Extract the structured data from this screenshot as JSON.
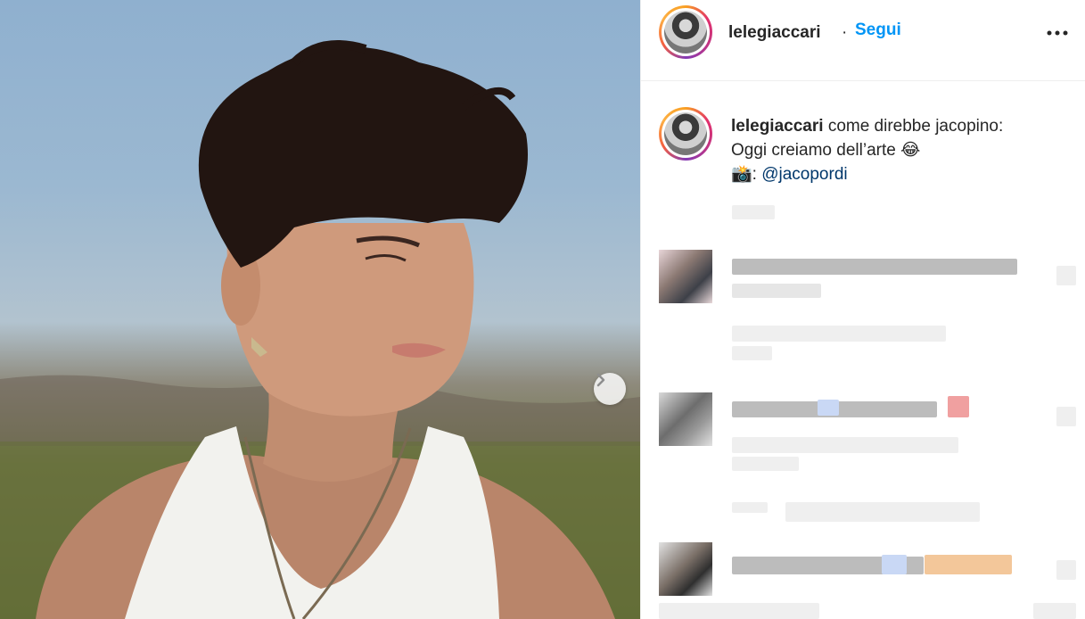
{
  "post": {
    "username": "lelegiaccari",
    "separator": "·",
    "follow_label": "Segui",
    "more_icon": "more-options-icon",
    "next_icon": "chevron-right-icon"
  },
  "caption": {
    "username": "lelegiaccari",
    "line1": "come direbbe jacopino:",
    "line2": "Oggi creiamo dell’arte 😂",
    "line3_prefix": "📸: ",
    "mention": "@jacopordi"
  },
  "colors": {
    "accent": "#0095f6",
    "mention": "#00376b",
    "text": "#262626",
    "divider": "#efefef"
  }
}
